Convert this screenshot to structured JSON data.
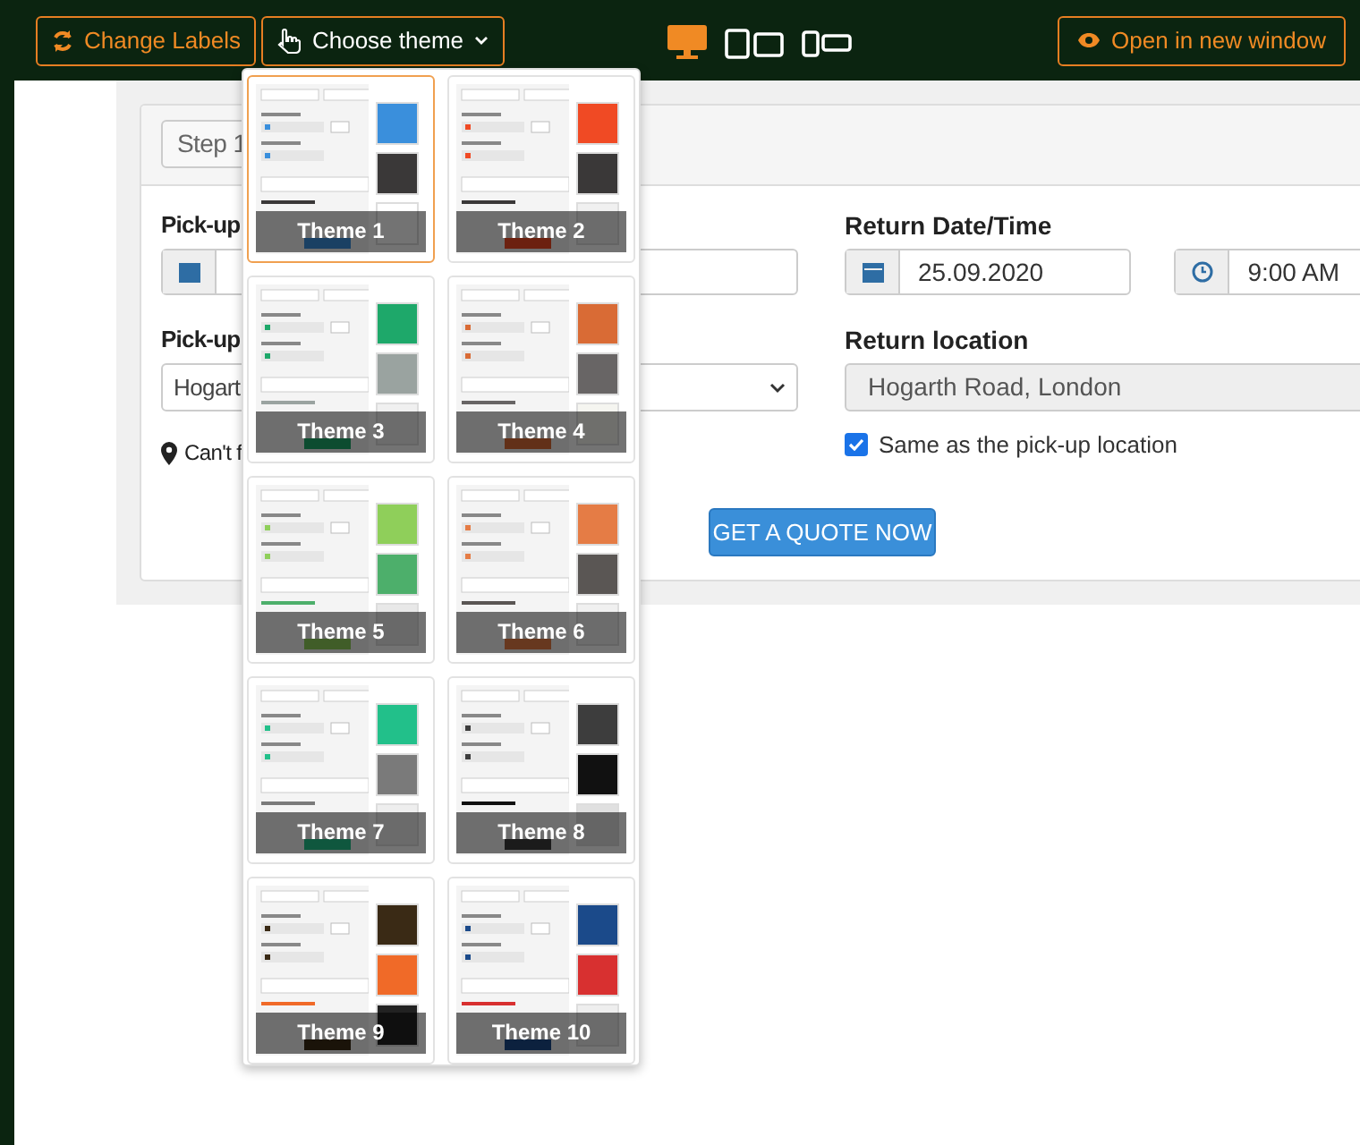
{
  "toolbar": {
    "change_labels": "Change Labels",
    "choose_theme": "Choose theme",
    "open_new_window": "Open in new window",
    "devices": [
      {
        "kind": "desktop",
        "selected": true
      },
      {
        "kind": "tablet",
        "selected": false
      },
      {
        "kind": "phone",
        "selected": false
      }
    ]
  },
  "form": {
    "step_tab": "Step 1",
    "pickup_label": "Pick-up",
    "pickup_location_label": "Pick-up",
    "pickup_location": "Hogart",
    "cant_find": "Can't f",
    "return_label": "Return Date/Time",
    "return_date": "25.09.2020",
    "return_time": "9:00 AM",
    "return_location_label": "Return location",
    "return_location": {
      "value": "Hogarth Road, London",
      "disabled": true
    },
    "same_location": {
      "label": "Same as the pick-up location",
      "checked": true
    },
    "quote_button": "GET A QUOTE NOW"
  },
  "themes": [
    {
      "name": "Theme 1",
      "selected": true,
      "swatches": [
        {
          "color": "#3a8fdc"
        },
        {
          "color": "#3a3838"
        },
        {
          "color": "#ffffff"
        }
      ]
    },
    {
      "name": "Theme 2",
      "selected": false,
      "swatches": [
        {
          "color": "#f04a24"
        },
        {
          "color": "#3a3838"
        },
        {
          "color": "#f0f0f0"
        }
      ]
    },
    {
      "name": "Theme 3",
      "selected": false,
      "swatches": [
        {
          "color": "#1ea86a"
        },
        {
          "color": "#9aa3a0"
        },
        {
          "color": "#f0f0f0"
        }
      ]
    },
    {
      "name": "Theme 4",
      "selected": false,
      "swatches": [
        {
          "color": "#d96b35"
        },
        {
          "color": "#686565"
        },
        {
          "color": "#f5f5f0"
        }
      ]
    },
    {
      "name": "Theme 5",
      "selected": false,
      "swatches": [
        {
          "color": "#8fcf5a"
        },
        {
          "color": "#4daf6b"
        },
        {
          "color": "#e8e8e8"
        }
      ]
    },
    {
      "name": "Theme 6",
      "selected": false,
      "swatches": [
        {
          "color": "#e57c45"
        },
        {
          "color": "#5a5654"
        },
        {
          "color": "#f0f0f0"
        }
      ]
    },
    {
      "name": "Theme 7",
      "selected": false,
      "swatches": [
        {
          "color": "#22c08a"
        },
        {
          "color": "#7a7a7a"
        },
        {
          "color": "#eeeeee"
        }
      ]
    },
    {
      "name": "Theme 8",
      "selected": false,
      "swatches": [
        {
          "color": "#3d3d3d"
        },
        {
          "color": "#111111"
        },
        {
          "color": "#e0e0e0"
        }
      ]
    },
    {
      "name": "Theme 9",
      "selected": false,
      "swatches": [
        {
          "color": "#3a2a15"
        },
        {
          "color": "#f06a28"
        },
        {
          "color": "#222222"
        }
      ]
    },
    {
      "name": "Theme 10",
      "selected": false,
      "swatches": [
        {
          "color": "#1b4a8a"
        },
        {
          "color": "#d83030"
        },
        {
          "color": "#eeeeee"
        }
      ]
    }
  ]
}
